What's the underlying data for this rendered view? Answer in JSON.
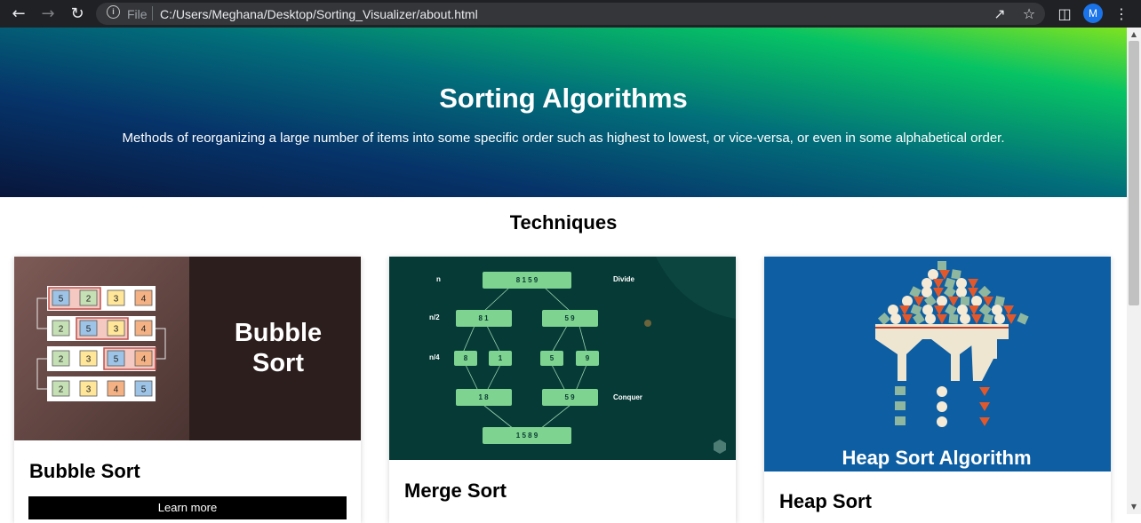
{
  "browser": {
    "omnibox_label": "File",
    "url": "C:/Users/Meghana/Desktop/Sorting_Visualizer/about.html",
    "profile_initial": "M"
  },
  "hero": {
    "title": "Sorting Algorithms",
    "subtitle": "Methods of reorganizing a large number of items into some specific order such as highest to lowest, or vice-versa, or even in some alphabetical order."
  },
  "techniques": {
    "heading": "Techniques",
    "cards": [
      {
        "title": "Bubble Sort",
        "button_label": "Learn more",
        "image_text": [
          "Bubble",
          "Sort"
        ],
        "rows": [
          [
            "5",
            "2",
            "3",
            "4"
          ],
          [
            "2",
            "5",
            "3",
            "4"
          ],
          [
            "2",
            "3",
            "5",
            "4"
          ],
          [
            "2",
            "3",
            "4",
            "5"
          ]
        ]
      },
      {
        "title": "Merge Sort",
        "image_text": {
          "labels": [
            "n",
            "n/2",
            "n/4",
            "Divide",
            "Conquer"
          ],
          "top": "8 1 5 9",
          "left_half": "8 1",
          "right_half": "5 9",
          "quarters": [
            "8",
            "1",
            "5",
            "9"
          ],
          "merged_left": "1 8",
          "merged_right": "5 9",
          "result": "1 5 8 9"
        }
      },
      {
        "title": "Heap Sort",
        "image_caption": "Heap Sort Algorithm"
      }
    ]
  },
  "colors": {
    "cell_blue": "#9dc3e6",
    "cell_green": "#c5e0b4",
    "cell_yellow": "#ffe699",
    "cell_orange": "#f4b183",
    "merge_node": "#7dd38f",
    "heap_bg": "#0d5ea2"
  }
}
